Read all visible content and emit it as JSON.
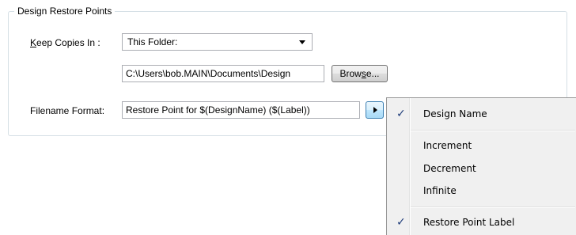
{
  "group": {
    "title": "Design Restore Points"
  },
  "keep_copies": {
    "label_accel": "K",
    "label_rest": "eep Copies In :",
    "value": "This Folder:"
  },
  "folder_path": {
    "value": "C:\\Users\\bob.MAIN\\Documents\\Design"
  },
  "browse_button": {
    "label_pre": "Brow",
    "label_accel": "s",
    "label_post": "e..."
  },
  "filename_format": {
    "label": "Filename Format:",
    "value": "Restore Point for $(DesignName) ($(Label))"
  },
  "menu": {
    "items": [
      {
        "label": "Design Name",
        "checked": true
      },
      {
        "label": "Increment",
        "checked": false
      },
      {
        "label": "Decrement",
        "checked": false
      },
      {
        "label": "Infinite",
        "checked": false
      },
      {
        "label": "Restore Point Label",
        "checked": true
      }
    ],
    "check_glyph": "✓"
  }
}
